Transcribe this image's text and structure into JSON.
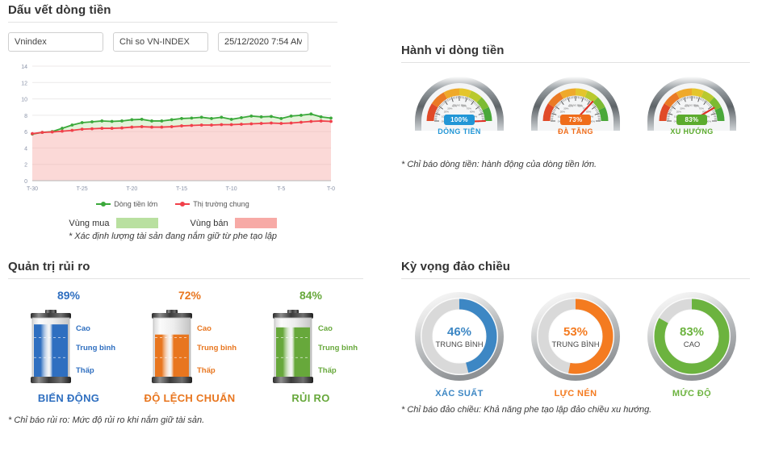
{
  "money_trail": {
    "title": "Dấu vết dòng tiền",
    "inputs": {
      "symbol": "Vnindex",
      "index_name": "Chi so VN-INDEX",
      "timestamp": "25/12/2020 7:54 AM"
    },
    "legend": {
      "series_big_money": "Dòng tiền lớn",
      "series_market": "Thị trường chung",
      "buy_zone": "Vùng mua",
      "sell_zone": "Vùng bán"
    },
    "footnote": "* Xác định lượng tài sản đang nắm giữ từ phe tạo lập",
    "colors": {
      "big_money": "#3ba93b",
      "market": "#f1404a",
      "buy_zone": "#b9e0a0",
      "sell_zone": "#f7aaa6"
    }
  },
  "behavior": {
    "title": "Hành vi dòng tiền",
    "footnote": "* Chỉ báo dòng tiền: hành động của dòng tiền lớn.",
    "gauges": [
      {
        "value": 100,
        "value_label": "100%",
        "caption": "DÒNG TIỀN",
        "color": "#2196d6"
      },
      {
        "value": 73,
        "value_label": "73%",
        "caption": "ĐÀ TĂNG",
        "color": "#ef6c1a"
      },
      {
        "value": 83,
        "value_label": "83%",
        "caption": "XU HƯỚNG",
        "color": "#5cab2e"
      }
    ],
    "scale_ticks": [
      "0%",
      "10%",
      "20%",
      "30%",
      "40%",
      "TRUNG BÌNH",
      "60%",
      "70%",
      "80%",
      "90%",
      "100%"
    ]
  },
  "risk": {
    "title": "Quản trị rủi ro",
    "footnote": "* Chỉ báo rủi ro: Mức độ rủi ro khi nắm giữ tài sản.",
    "level_labels": {
      "high": "Cao",
      "medium": "Trung bình",
      "low": "Thấp"
    },
    "batteries": [
      {
        "value": 89,
        "value_label": "89%",
        "title": "BIẾN ĐỘNG",
        "color": "#2f6fc0"
      },
      {
        "value": 72,
        "value_label": "72%",
        "title": "ĐỘ LỆCH CHUẨN",
        "color": "#e8761f"
      },
      {
        "value": 84,
        "value_label": "84%",
        "title": "RỦI RO",
        "color": "#67a83b"
      }
    ]
  },
  "reversal": {
    "title": "Kỳ vọng đảo chiều",
    "footnote": "* Chỉ báo đảo chiều: Khả năng phe tạo lập đảo chiều xu hướng.",
    "donuts": [
      {
        "value": 46,
        "value_label": "46%",
        "status": "TRUNG BÌNH",
        "label": "XÁC SUẤT",
        "color": "#3d87c4"
      },
      {
        "value": 53,
        "value_label": "53%",
        "status": "TRUNG BÌNH",
        "label": "LỰC NÉN",
        "color": "#f47b20"
      },
      {
        "value": 83,
        "value_label": "83%",
        "status": "CAO",
        "label": "MỨC ĐỘ",
        "color": "#6cb33f"
      }
    ]
  },
  "chart_data": {
    "type": "line",
    "title": "Dấu vết dòng tiền",
    "xlabel": "",
    "ylabel": "",
    "ylim": [
      0,
      14
    ],
    "yticks": [
      0,
      2,
      4,
      6,
      8,
      10,
      12,
      14
    ],
    "xticks": [
      "T-30",
      "T-25",
      "T-20",
      "T-15",
      "T-10",
      "T-5",
      "T-0"
    ],
    "x": [
      "T-30",
      "T-29",
      "T-28",
      "T-27",
      "T-26",
      "T-25",
      "T-24",
      "T-23",
      "T-22",
      "T-21",
      "T-20",
      "T-19",
      "T-18",
      "T-17",
      "T-16",
      "T-15",
      "T-14",
      "T-13",
      "T-12",
      "T-11",
      "T-10",
      "T-9",
      "T-8",
      "T-7",
      "T-6",
      "T-5",
      "T-4",
      "T-3",
      "T-2",
      "T-1",
      "T-0"
    ],
    "grid": true,
    "legend_position": "bottom",
    "series": [
      {
        "name": "Dòng tiền lớn",
        "color": "#3ba93b",
        "values": [
          5.7,
          5.9,
          6.0,
          6.4,
          6.8,
          7.1,
          7.2,
          7.3,
          7.25,
          7.3,
          7.45,
          7.5,
          7.3,
          7.3,
          7.45,
          7.6,
          7.65,
          7.75,
          7.6,
          7.75,
          7.5,
          7.7,
          7.9,
          7.8,
          7.85,
          7.6,
          7.9,
          8.0,
          8.15,
          7.8,
          7.65
        ]
      },
      {
        "name": "Thị trường chung",
        "color": "#f1404a",
        "values": [
          5.75,
          5.9,
          5.95,
          6.05,
          6.15,
          6.3,
          6.35,
          6.4,
          6.4,
          6.45,
          6.55,
          6.6,
          6.55,
          6.55,
          6.6,
          6.7,
          6.75,
          6.8,
          6.8,
          6.85,
          6.85,
          6.9,
          6.95,
          7.0,
          7.05,
          7.0,
          7.05,
          7.15,
          7.25,
          7.3,
          7.25
        ]
      }
    ]
  }
}
